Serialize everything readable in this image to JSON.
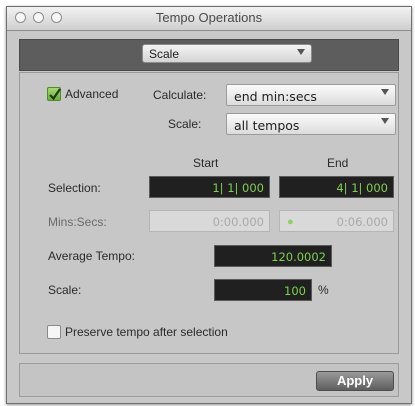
{
  "window": {
    "title": "Tempo Operations"
  },
  "operation_menu": {
    "selected": "Scale"
  },
  "advanced": {
    "label": "Advanced",
    "checked": true
  },
  "calculate": {
    "label": "Calculate:",
    "selected": "end min:secs"
  },
  "scale_menu": {
    "label": "Scale:",
    "selected": "all tempos"
  },
  "columns": {
    "start": "Start",
    "end": "End"
  },
  "selection": {
    "label": "Selection:",
    "start": "1| 1| 000",
    "end": "4| 1| 000"
  },
  "mins_secs": {
    "label": "Mins:Secs:",
    "start": "0:00.000",
    "end": "0:06.000"
  },
  "average_tempo": {
    "label": "Average Tempo:",
    "value": "120.0002"
  },
  "scale_value": {
    "label": "Scale:",
    "value": "100",
    "unit": "%"
  },
  "preserve": {
    "label": "Preserve tempo after selection",
    "checked": false
  },
  "apply_button": {
    "label": "Apply"
  }
}
